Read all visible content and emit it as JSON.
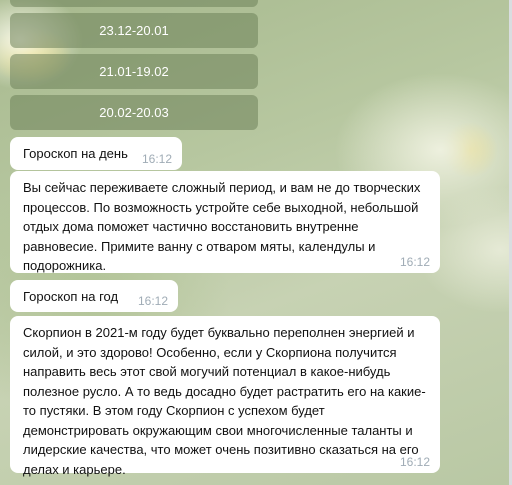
{
  "keyboard": {
    "buttons": [
      {
        "label": ""
      },
      {
        "label": "23.12-20.01"
      },
      {
        "label": "21.01-19.02"
      },
      {
        "label": "20.02-20.03"
      }
    ]
  },
  "messages": [
    {
      "text": "Гороскоп на день",
      "time": "16:12"
    },
    {
      "text": "Вы сейчас переживаете сложный период, и вам не до творческих процессов. По возможность устройте себе выходной, небольшой отдых дома поможет частично восстановить внутренне равновесие. Примите ванну с отваром мяты, календулы и подорожника.",
      "time": "16:12"
    },
    {
      "text": "Гороскоп на год",
      "time": "16:12"
    },
    {
      "text": "Скорпион в 2021-м году будет буквально переполнен энергией и силой, и это здорово! Особенно, если у Скорпиона получится направить весь этот свой могучий потенциал в какое-нибудь полезное русло. А то ведь досадно будет растратить его на какие-то пустяки. В этом году Скорпион с успехом будет демонстрировать окружающим свои многочисленные таланты и лидерские качества, что может очень позитивно сказаться на его делах и карьере.",
      "time": "16:12"
    }
  ]
}
